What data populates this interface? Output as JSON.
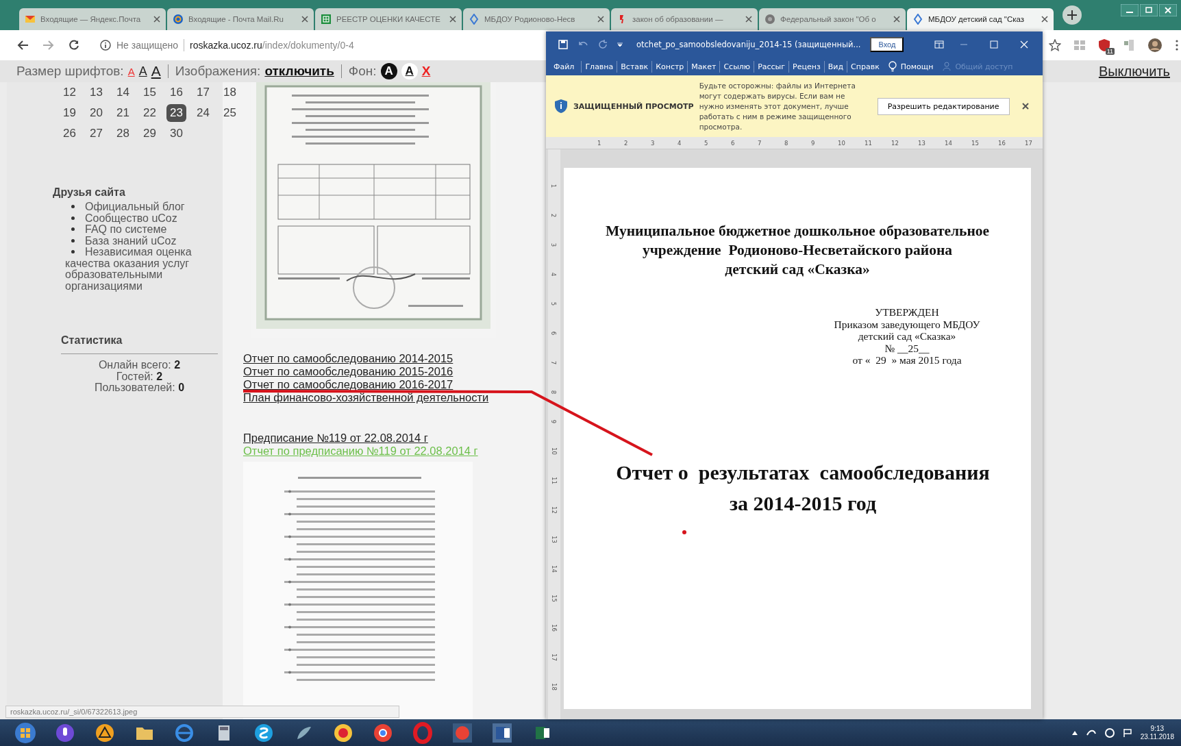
{
  "browser": {
    "tabs": [
      {
        "label": "Входящие — Яндекс.Почта",
        "kind": "envelope",
        "selected": false
      },
      {
        "label": "Входящие - Почта Mail.Ru",
        "kind": "at",
        "selected": false
      },
      {
        "label": "РЕЕСТР ОЦЕНКИ КАЧЕСТЕ",
        "kind": "sheet",
        "selected": false
      },
      {
        "label": "МБДОУ Родионово-Несв",
        "kind": "site",
        "selected": false
      },
      {
        "label": "закон об образовании —",
        "kind": "yandex",
        "selected": false
      },
      {
        "label": "Федеральный закон \"Об о",
        "kind": "emblem",
        "selected": false
      },
      {
        "label": "МБДОУ детский сад \"Сказ",
        "kind": "site",
        "selected": true
      }
    ],
    "address": {
      "security": "Не защищено",
      "host": "roskazka.ucoz.ru",
      "path": "/index/dokumenty/0-4"
    },
    "extension_badge": "11",
    "status_url": "roskazka.ucoz.ru/_si/0/67322613.jpeg"
  },
  "accessibility_bar": {
    "font_size_label": "Размер шрифтов:",
    "font_sizes": [
      "A",
      "A",
      "A"
    ],
    "images_label": "Изображения:",
    "images_link": "отключить",
    "background_label": "Фон:",
    "backgrounds": [
      {
        "label": "A",
        "kind": "dark"
      },
      {
        "label": "A",
        "kind": "light"
      }
    ],
    "reset": "X",
    "off_link": "Выключить"
  },
  "sidebar": {
    "calendar": [
      {
        "day": "12",
        "selected": false
      },
      {
        "day": "13",
        "selected": false
      },
      {
        "day": "14",
        "selected": false
      },
      {
        "day": "15",
        "selected": false
      },
      {
        "day": "16",
        "selected": false
      },
      {
        "day": "17",
        "selected": false
      },
      {
        "day": "18",
        "selected": false
      },
      {
        "day": "19",
        "selected": false
      },
      {
        "day": "20",
        "selected": false
      },
      {
        "day": "21",
        "selected": false
      },
      {
        "day": "22",
        "selected": false
      },
      {
        "day": "23",
        "selected": true
      },
      {
        "day": "24",
        "selected": false
      },
      {
        "day": "25",
        "selected": false
      },
      {
        "day": "26",
        "selected": false
      },
      {
        "day": "27",
        "selected": false
      },
      {
        "day": "28",
        "selected": false
      },
      {
        "day": "29",
        "selected": false
      },
      {
        "day": "30",
        "selected": false
      }
    ],
    "friends": {
      "title": "Друзья сайта",
      "items": [
        "Официальный блог",
        "Сообщество uCoz",
        "FAQ по системе",
        "База знаний uCoz",
        "Независимая оценка качества оказания услуг образовательными организациями"
      ]
    },
    "stats": {
      "title": "Статистика",
      "lines": [
        "Онлайн всего: **2**",
        "Гостей: **2**",
        "Пользователей: **0**"
      ]
    }
  },
  "content": {
    "reports": [
      {
        "text": "Отчет по самообследованию 2014-2015",
        "color": "#222222"
      },
      {
        "text": "Отчет по самообследованию 2015-2016",
        "color": "#222222"
      },
      {
        "text": "Отчет по самообследованию 2016-2017",
        "color": "#222222"
      },
      {
        "text": "План финансово-хозяйственной деятельности",
        "color": "#222222"
      }
    ],
    "orders": [
      {
        "text": "Предписание №119 от 22.08.2014 г",
        "color": "#222222"
      },
      {
        "text": "Отчет по предписанию №119 от 22.08.2014 г",
        "color": "#6cbf4a"
      }
    ]
  },
  "word": {
    "title": "otchet_po_samoobsledovaniju_2014-15 (защищенный...",
    "sign_in": "Вход",
    "ribbon_tabs": [
      {
        "label": "Файл",
        "selected": false
      },
      {
        "label": "Главна",
        "selected": false
      },
      {
        "label": "Вставк",
        "selected": false
      },
      {
        "label": "Констр",
        "selected": false
      },
      {
        "label": "Макет",
        "selected": false
      },
      {
        "label": "Ссылю",
        "selected": false
      },
      {
        "label": "Рассыг",
        "selected": false
      },
      {
        "label": "Реценз",
        "selected": false
      },
      {
        "label": "Вид",
        "selected": false
      },
      {
        "label": "Справк",
        "selected": false
      }
    ],
    "help": "Помощн",
    "share": {
      "label": "Общий доступ",
      "disabled": true
    },
    "protected_view": {
      "title": "ЗАЩИЩЕННЫЙ ПРОСМОТР",
      "message": "Будьте осторожны: файлы из Интернета могут содержать вирусы. Если вам не нужно изменять этот документ, лучше работать с ним в режиме защищенного просмотра.",
      "button": "Разрешить редактирование"
    },
    "ruler": [
      "1",
      "2",
      "3",
      "4",
      "5",
      "6",
      "7",
      "8",
      "9",
      "10",
      "11",
      "12",
      "13",
      "14",
      "15",
      "16",
      "17"
    ],
    "vertical_ruler": [
      "1",
      "2",
      "3",
      "4",
      "5",
      "6",
      "7",
      "8",
      "9",
      "10",
      "11",
      "12",
      "13",
      "14",
      "15",
      "16",
      "17",
      "18"
    ],
    "document": {
      "heading": [
        "Муниципальное бюджетное дошкольное образовательное",
        "учреждение  Родионово-Несветайского района",
        "детский сад «Сказка»"
      ],
      "approval": [
        "УТВЕРЖДЕН",
        "Приказом заведующего МБДОУ",
        "детский сад «Сказка»",
        "№ __25__",
        "от «  29  » мая 2015 года"
      ],
      "title": [
        "Отчет о  результатах  самообследования",
        "за 2014-2015 год"
      ]
    }
  },
  "taskbar": {
    "time": "9:13",
    "date": "23.11.2018"
  }
}
